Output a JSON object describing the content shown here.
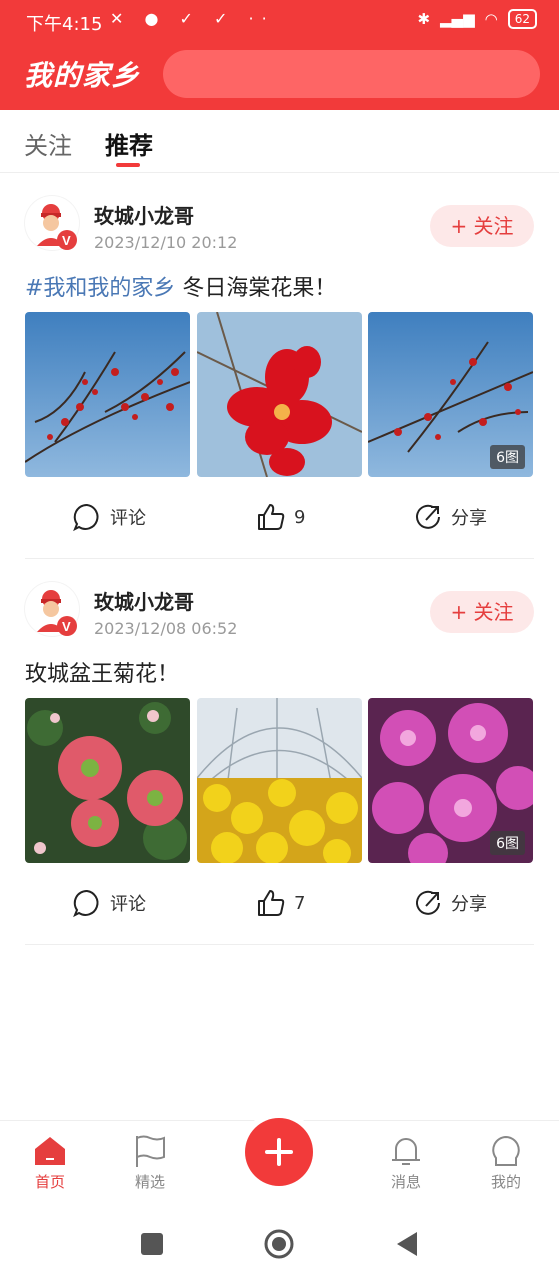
{
  "status_bar": {
    "time": "下午4:15",
    "notif_icons": "✕ ● ✓ ✓ ··",
    "battery": "62"
  },
  "header": {
    "title": "我的家乡",
    "search_placeholder": ""
  },
  "tabs": [
    {
      "label": "关注"
    },
    {
      "label": "推荐"
    }
  ],
  "posts": [
    {
      "author": "玫城小龙哥",
      "time": "2023/12/10 20:12",
      "follow": "+ 关注",
      "tag": "#我和我的家乡",
      "text": " 冬日海棠花果！",
      "image_count": "6图",
      "comment": "评论",
      "likes": "9",
      "share": "分享"
    },
    {
      "author": "玫城小龙哥",
      "time": "2023/12/08 06:52",
      "follow": "+ 关注",
      "tag": "",
      "text": "玫城盆王菊花！",
      "image_count": "6图",
      "comment": "评论",
      "likes": "7",
      "share": "分享"
    }
  ],
  "bottom_nav": [
    {
      "label": "首页"
    },
    {
      "label": "精选"
    },
    {
      "label": "消息"
    },
    {
      "label": "我的"
    }
  ],
  "colors": {
    "brand": "#f23a3a",
    "tag": "#4a78b5",
    "follow_bg": "#fde8e8"
  }
}
